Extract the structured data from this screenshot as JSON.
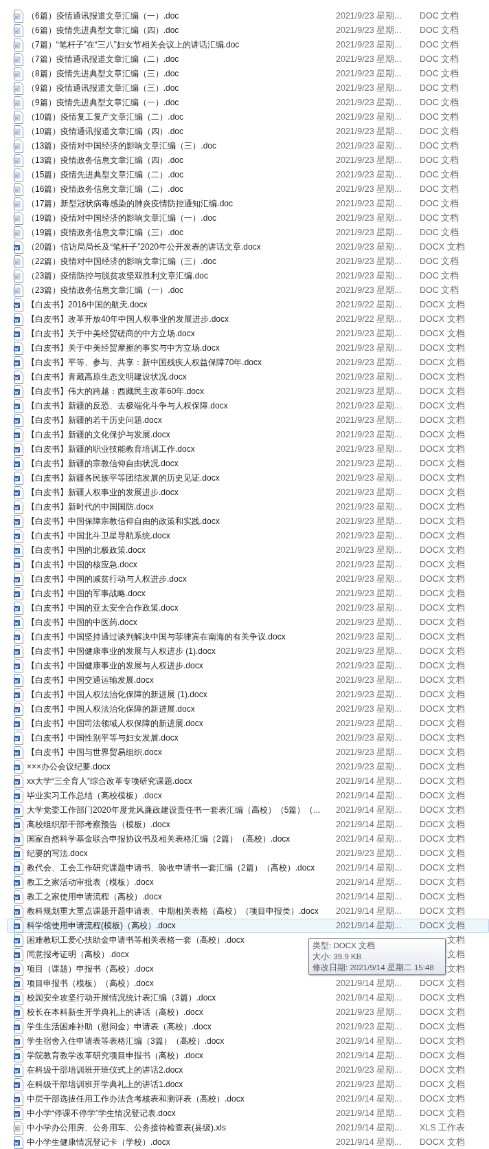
{
  "files": [
    {
      "kind": "doc",
      "name": "（6篇）疫情通讯报道文章汇编（一）.doc",
      "date": "2021/9/23 星期...",
      "type": "DOC 文档",
      "hovered": false
    },
    {
      "kind": "doc",
      "name": "（6篇）疫情先进典型文章汇编（四）.doc",
      "date": "2021/9/23 星期...",
      "type": "DOC 文档",
      "hovered": false
    },
    {
      "kind": "doc",
      "name": "（7篇）“笔杆子”在“三八”妇女节相关会议上的讲话汇编.doc",
      "date": "2021/9/23 星期...",
      "type": "DOC 文档",
      "hovered": false
    },
    {
      "kind": "doc",
      "name": "（7篇）疫情通讯报道文章汇编（二）.doc",
      "date": "2021/9/23 星期...",
      "type": "DOC 文档",
      "hovered": false
    },
    {
      "kind": "doc",
      "name": "（8篇）疫情先进典型文章汇编（三）.doc",
      "date": "2021/9/23 星期...",
      "type": "DOC 文档",
      "hovered": false
    },
    {
      "kind": "doc",
      "name": "（9篇）疫情通讯报道文章汇编（三）.doc",
      "date": "2021/9/23 星期...",
      "type": "DOC 文档",
      "hovered": false
    },
    {
      "kind": "doc",
      "name": "（9篇）疫情先进典型文章汇编（一）.doc",
      "date": "2021/9/23 星期...",
      "type": "DOC 文档",
      "hovered": false
    },
    {
      "kind": "doc",
      "name": "（10篇）疫情复工复产文章汇编（二）.doc",
      "date": "2021/9/23 星期...",
      "type": "DOC 文档",
      "hovered": false
    },
    {
      "kind": "doc",
      "name": "（10篇）疫情通讯报道文章汇编（四）.doc",
      "date": "2021/9/23 星期...",
      "type": "DOC 文档",
      "hovered": false
    },
    {
      "kind": "doc",
      "name": "（13篇）疫情对中国经济的影响文章汇编（三）.doc",
      "date": "2021/9/23 星期...",
      "type": "DOC 文档",
      "hovered": false
    },
    {
      "kind": "doc",
      "name": "（13篇）疫情政务信息文章汇编（四）.doc",
      "date": "2021/9/23 星期...",
      "type": "DOC 文档",
      "hovered": false
    },
    {
      "kind": "doc",
      "name": "（15篇）疫情先进典型文章汇编（二）.doc",
      "date": "2021/9/23 星期...",
      "type": "DOC 文档",
      "hovered": false
    },
    {
      "kind": "doc",
      "name": "（16篇）疫情政务信息文章汇编（二）.doc",
      "date": "2021/9/23 星期...",
      "type": "DOC 文档",
      "hovered": false
    },
    {
      "kind": "doc",
      "name": "（17篇）新型冠状病毒感染的肺炎疫情防控通知汇编.doc",
      "date": "2021/9/23 星期...",
      "type": "DOC 文档",
      "hovered": false
    },
    {
      "kind": "doc",
      "name": "（19篇）疫情对中国经济的影响文章汇编（一）.doc",
      "date": "2021/9/23 星期...",
      "type": "DOC 文档",
      "hovered": false
    },
    {
      "kind": "doc",
      "name": "（19篇）疫情政务信息文章汇编（三）.doc",
      "date": "2021/9/23 星期...",
      "type": "DOC 文档",
      "hovered": false
    },
    {
      "kind": "docx",
      "name": "（20篇）信访局局长及“笔杆子”2020年公开发表的讲话文章.docx",
      "date": "2021/9/23 星期...",
      "type": "DOCX 文档",
      "hovered": false
    },
    {
      "kind": "doc",
      "name": "（22篇）疫情对中国经济的影响文章汇编（三）.doc",
      "date": "2021/9/23 星期...",
      "type": "DOC 文档",
      "hovered": false
    },
    {
      "kind": "doc",
      "name": "（23篇）疫情防控与脱贫攻坚双胜利文章汇编.doc",
      "date": "2021/9/23 星期...",
      "type": "DOC 文档",
      "hovered": false
    },
    {
      "kind": "doc",
      "name": "（23篇）疫情政务信息文章汇编（一）.doc",
      "date": "2021/9/23 星期...",
      "type": "DOC 文档",
      "hovered": false
    },
    {
      "kind": "docx",
      "name": "【白皮书】2016中国的航天.docx",
      "date": "2021/9/22 星期...",
      "type": "DOCX 文档",
      "hovered": false
    },
    {
      "kind": "docx",
      "name": "【白皮书】改革开放40年中国人权事业的发展进步.docx",
      "date": "2021/9/22 星期...",
      "type": "DOCX 文档",
      "hovered": false
    },
    {
      "kind": "docx",
      "name": "【白皮书】关于中美经贸磋商的中方立场.docx",
      "date": "2021/9/23 星期...",
      "type": "DOCX 文档",
      "hovered": false
    },
    {
      "kind": "docx",
      "name": "【白皮书】关于中美经贸摩擦的事实与中方立场.docx",
      "date": "2021/9/23 星期...",
      "type": "DOCX 文档",
      "hovered": false
    },
    {
      "kind": "docx",
      "name": "【白皮书】平等、参与、共享：新中国残疾人权益保障70年.docx",
      "date": "2021/9/23 星期...",
      "type": "DOCX 文档",
      "hovered": false
    },
    {
      "kind": "docx",
      "name": "【白皮书】青藏高原生态文明建设状况.docx",
      "date": "2021/9/23 星期...",
      "type": "DOCX 文档",
      "hovered": false
    },
    {
      "kind": "docx",
      "name": "【白皮书】伟大的跨越：西藏民主改革60年.docx",
      "date": "2021/9/23 星期...",
      "type": "DOCX 文档",
      "hovered": false
    },
    {
      "kind": "docx",
      "name": "【白皮书】新疆的反恐、去极端化斗争与人权保障.docx",
      "date": "2021/9/23 星期...",
      "type": "DOCX 文档",
      "hovered": false
    },
    {
      "kind": "docx",
      "name": "【白皮书】新疆的若干历史问题.docx",
      "date": "2021/9/23 星期...",
      "type": "DOCX 文档",
      "hovered": false
    },
    {
      "kind": "docx",
      "name": "【白皮书】新疆的文化保护与发展.docx",
      "date": "2021/9/23 星期...",
      "type": "DOCX 文档",
      "hovered": false
    },
    {
      "kind": "docx",
      "name": "【白皮书】新疆的职业技能教育培训工作.docx",
      "date": "2021/9/23 星期...",
      "type": "DOCX 文档",
      "hovered": false
    },
    {
      "kind": "docx",
      "name": "【白皮书】新疆的宗教信仰自由状况.docx",
      "date": "2021/9/23 星期...",
      "type": "DOCX 文档",
      "hovered": false
    },
    {
      "kind": "docx",
      "name": "【白皮书】新疆各民族平等团结发展的历史见证.docx",
      "date": "2021/9/23 星期...",
      "type": "DOCX 文档",
      "hovered": false
    },
    {
      "kind": "docx",
      "name": "【白皮书】新疆人权事业的发展进步.docx",
      "date": "2021/9/23 星期...",
      "type": "DOCX 文档",
      "hovered": false
    },
    {
      "kind": "docx",
      "name": "【白皮书】新时代的中国国防.docx",
      "date": "2021/9/23 星期...",
      "type": "DOCX 文档",
      "hovered": false
    },
    {
      "kind": "docx",
      "name": "【白皮书】中国保障宗教信仰自由的政策和实践.docx",
      "date": "2021/9/23 星期...",
      "type": "DOCX 文档",
      "hovered": false
    },
    {
      "kind": "docx",
      "name": "【白皮书】中国北斗卫星导航系统.docx",
      "date": "2021/9/23 星期...",
      "type": "DOCX 文档",
      "hovered": false
    },
    {
      "kind": "docx",
      "name": "【白皮书】中国的北极政策.docx",
      "date": "2021/9/23 星期...",
      "type": "DOCX 文档",
      "hovered": false
    },
    {
      "kind": "docx",
      "name": "【白皮书】中国的核应急.docx",
      "date": "2021/9/23 星期...",
      "type": "DOCX 文档",
      "hovered": false
    },
    {
      "kind": "docx",
      "name": "【白皮书】中国的减贫行动与人权进步.docx",
      "date": "2021/9/23 星期...",
      "type": "DOCX 文档",
      "hovered": false
    },
    {
      "kind": "docx",
      "name": "【白皮书】中国的军事战略.docx",
      "date": "2021/9/23 星期...",
      "type": "DOCX 文档",
      "hovered": false
    },
    {
      "kind": "docx",
      "name": "【白皮书】中国的亚太安全合作政策.docx",
      "date": "2021/9/23 星期...",
      "type": "DOCX 文档",
      "hovered": false
    },
    {
      "kind": "docx",
      "name": "【白皮书】中国的中医药.docx",
      "date": "2021/9/23 星期...",
      "type": "DOCX 文档",
      "hovered": false
    },
    {
      "kind": "docx",
      "name": "【白皮书】中国坚持通过谈判解决中国与菲律宾在南海的有关争议.docx",
      "date": "2021/9/23 星期...",
      "type": "DOCX 文档",
      "hovered": false
    },
    {
      "kind": "docx",
      "name": "【白皮书】中国健康事业的发展与人权进步 (1).docx",
      "date": "2021/9/23 星期...",
      "type": "DOCX 文档",
      "hovered": false
    },
    {
      "kind": "docx",
      "name": "【白皮书】中国健康事业的发展与人权进步.docx",
      "date": "2021/9/23 星期...",
      "type": "DOCX 文档",
      "hovered": false
    },
    {
      "kind": "docx",
      "name": "【白皮书】中国交通运输发展.docx",
      "date": "2021/9/23 星期...",
      "type": "DOCX 文档",
      "hovered": false
    },
    {
      "kind": "docx",
      "name": "【白皮书】中国人权法治化保障的新进展 (1).docx",
      "date": "2021/9/23 星期...",
      "type": "DOCX 文档",
      "hovered": false
    },
    {
      "kind": "docx",
      "name": "【白皮书】中国人权法治化保障的新进展.docx",
      "date": "2021/9/23 星期...",
      "type": "DOCX 文档",
      "hovered": false
    },
    {
      "kind": "docx",
      "name": "【白皮书】中国司法领域人权保障的新进展.docx",
      "date": "2021/9/23 星期...",
      "type": "DOCX 文档",
      "hovered": false
    },
    {
      "kind": "docx",
      "name": "【白皮书】中国性别平等与妇女发展.docx",
      "date": "2021/9/23 星期...",
      "type": "DOCX 文档",
      "hovered": false
    },
    {
      "kind": "docx",
      "name": "【白皮书】中国与世界贸易组织.docx",
      "date": "2021/9/23 星期...",
      "type": "DOCX 文档",
      "hovered": false
    },
    {
      "kind": "docx",
      "name": "×××办公会议纪要.docx",
      "date": "2021/9/23 星期...",
      "type": "DOCX 文档",
      "hovered": false
    },
    {
      "kind": "docx",
      "name": "xx大学“三全育人”综合改革专项研究课题.docx",
      "date": "2021/9/14 星期...",
      "type": "DOCX 文档",
      "hovered": false
    },
    {
      "kind": "docx",
      "name": "毕业实习工作总结（高校模板）.docx",
      "date": "2021/9/14 星期...",
      "type": "DOCX 文档",
      "hovered": false
    },
    {
      "kind": "docx",
      "name": "大学党委工作部门2020年度党风廉政建设责任书一套表汇编（高校）（5篇）（...",
      "date": "2021/9/14 星期...",
      "type": "DOCX 文档",
      "hovered": false
    },
    {
      "kind": "docx",
      "name": "高校组织部干部考察预告（模板）.docx",
      "date": "2021/9/14 星期...",
      "type": "DOCX 文档",
      "hovered": false
    },
    {
      "kind": "docx",
      "name": "国家自然科学基金联合申报协议书及相关表格汇编（2篇）（高校）.docx",
      "date": "2021/9/14 星期...",
      "type": "DOCX 文档",
      "hovered": false
    },
    {
      "kind": "docx",
      "name": "纪要的写法.docx",
      "date": "2021/9/23 星期...",
      "type": "DOCX 文档",
      "hovered": false
    },
    {
      "kind": "docx",
      "name": "教代会、工会工作研究课题申请书、验收申请书一套汇编（2篇）（高校）.docx",
      "date": "2021/9/14 星期...",
      "type": "DOCX 文档",
      "hovered": false
    },
    {
      "kind": "docx",
      "name": "教工之家活动审批表（模板）.docx",
      "date": "2021/9/14 星期...",
      "type": "DOCX 文档",
      "hovered": false
    },
    {
      "kind": "docx",
      "name": "教工之家使用申请流程（高校）.docx",
      "date": "2021/9/14 星期...",
      "type": "DOCX 文档",
      "hovered": false
    },
    {
      "kind": "docx",
      "name": "教科规划重大重点课题开题申请表、中期相关表格（高校）（项目申报类）.docx",
      "date": "2021/9/14 星期...",
      "type": "DOCX 文档",
      "hovered": false
    },
    {
      "kind": "docx",
      "name": "科学馆使用申请流程(模板)（高校）.docx",
      "date": "2021/9/14 星期...",
      "type": "DOCX 文档",
      "hovered": true
    },
    {
      "kind": "docx",
      "name": "困难教职工爱心扶助金申请书等相关表格一套（高校）.docx",
      "type": "文档",
      "hovered": false
    },
    {
      "kind": "docx",
      "name": "同意报考证明（高校）.docx",
      "type": "文档",
      "hovered": false
    },
    {
      "kind": "docx",
      "name": "项目（课题）申报书（高校）.docx",
      "type": "文档",
      "hovered": false
    },
    {
      "kind": "docx",
      "name": "项目申报书（模板）（高校）.docx",
      "date": "2021/9/14 星期...",
      "type": "DOCX 文档",
      "hovered": false
    },
    {
      "kind": "docx",
      "name": "校园安全攻坚行动开展情况统计表汇编（3篇）.docx",
      "date": "2021/9/14 星期...",
      "type": "DOCX 文档",
      "hovered": false
    },
    {
      "kind": "docx",
      "name": "校长在本科新生开学典礼上的讲话（高校）.docx",
      "date": "2021/9/23 星期...",
      "type": "DOCX 文档",
      "hovered": false
    },
    {
      "kind": "docx",
      "name": "学生生活困难补助（慰问金）申请表（高校）.docx",
      "date": "2021/9/23 星期...",
      "type": "DOCX 文档",
      "hovered": false
    },
    {
      "kind": "docx",
      "name": "学生宿舍入住申请表等表格汇编（3篇）（高校）.docx",
      "date": "2021/9/14 星期...",
      "type": "DOCX 文档",
      "hovered": false
    },
    {
      "kind": "docx",
      "name": "学院教育教学改革研究项目申报书（高校）.docx",
      "date": "2021/9/14 星期...",
      "type": "DOCX 文档",
      "hovered": false
    },
    {
      "kind": "docx",
      "name": "在科级干部培训班开班仪式上的讲话2.docx",
      "date": "2021/9/23 星期...",
      "type": "DOCX 文档",
      "hovered": false
    },
    {
      "kind": "docx",
      "name": "在科级干部培训班开学典礼上的讲话1.docx",
      "date": "2021/9/23 星期...",
      "type": "DOCX 文档",
      "hovered": false
    },
    {
      "kind": "docx",
      "name": "中层干部选拔任用工作办法含考核表和测评表（高校）.docx",
      "date": "2021/9/14 星期...",
      "type": "DOCX 文档",
      "hovered": false
    },
    {
      "kind": "docx",
      "name": "中小学“停课不停学”学生情况登记表.docx",
      "date": "2021/9/14 星期...",
      "type": "DOCX 文档",
      "hovered": false
    },
    {
      "kind": "xls",
      "name": "中小学办公用房、公务用车、公务接待检查表(县级).xls",
      "date": "2021/9/14 星期...",
      "type": "XLS 工作表",
      "hovered": false
    },
    {
      "kind": "docx",
      "name": "中小学生健康情况登记卡（学校）.docx",
      "date": "2021/9/14 星期...",
      "type": "DOCX 文档",
      "hovered": false
    }
  ],
  "tooltip": {
    "lines": [
      "类型: DOCX 文档",
      "大小: 39.9 KB",
      "修改日期: 2021/9/14 星期二 15:48"
    ]
  }
}
